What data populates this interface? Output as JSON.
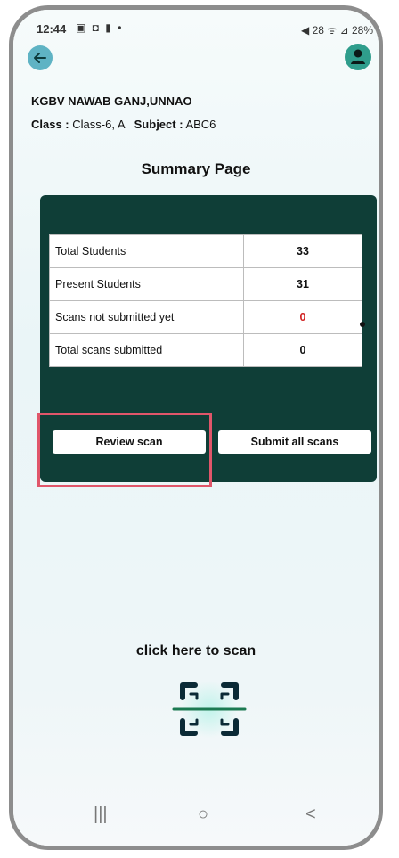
{
  "status_bar": {
    "time": "12:44",
    "left_icons": "▣ ◘ ▮ •",
    "right_icons": "◀ 28 ᯤ ⊿ 28%"
  },
  "header": {
    "back_icon": "arrow-left-icon",
    "avatar_icon": "user-icon"
  },
  "school": {
    "name": "KGBV NAWAB GANJ,UNNAO",
    "class_label": "Class :",
    "class_value": "Class-6, A",
    "subject_label": "Subject :",
    "subject_value": "ABC6"
  },
  "page_title": "Summary Page",
  "summary": {
    "rows": [
      {
        "label": "Total Students",
        "value": "33"
      },
      {
        "label": "Present Students",
        "value": "31"
      },
      {
        "label": "Scans not submitted yet",
        "value": "0"
      },
      {
        "label": "Total scans submitted",
        "value": "0"
      }
    ]
  },
  "actions": {
    "review_label": "Review scan",
    "submit_label": "Submit all scans"
  },
  "scan": {
    "label": "click here to scan",
    "icon": "scan-frame-icon"
  },
  "nav": {
    "recents": "|||",
    "home": "○",
    "back": "<"
  },
  "colors": {
    "card_bg": "#0f3e37",
    "highlight": "#e0566a",
    "alert_value": "#d02020",
    "accent": "#5fb3c4"
  }
}
